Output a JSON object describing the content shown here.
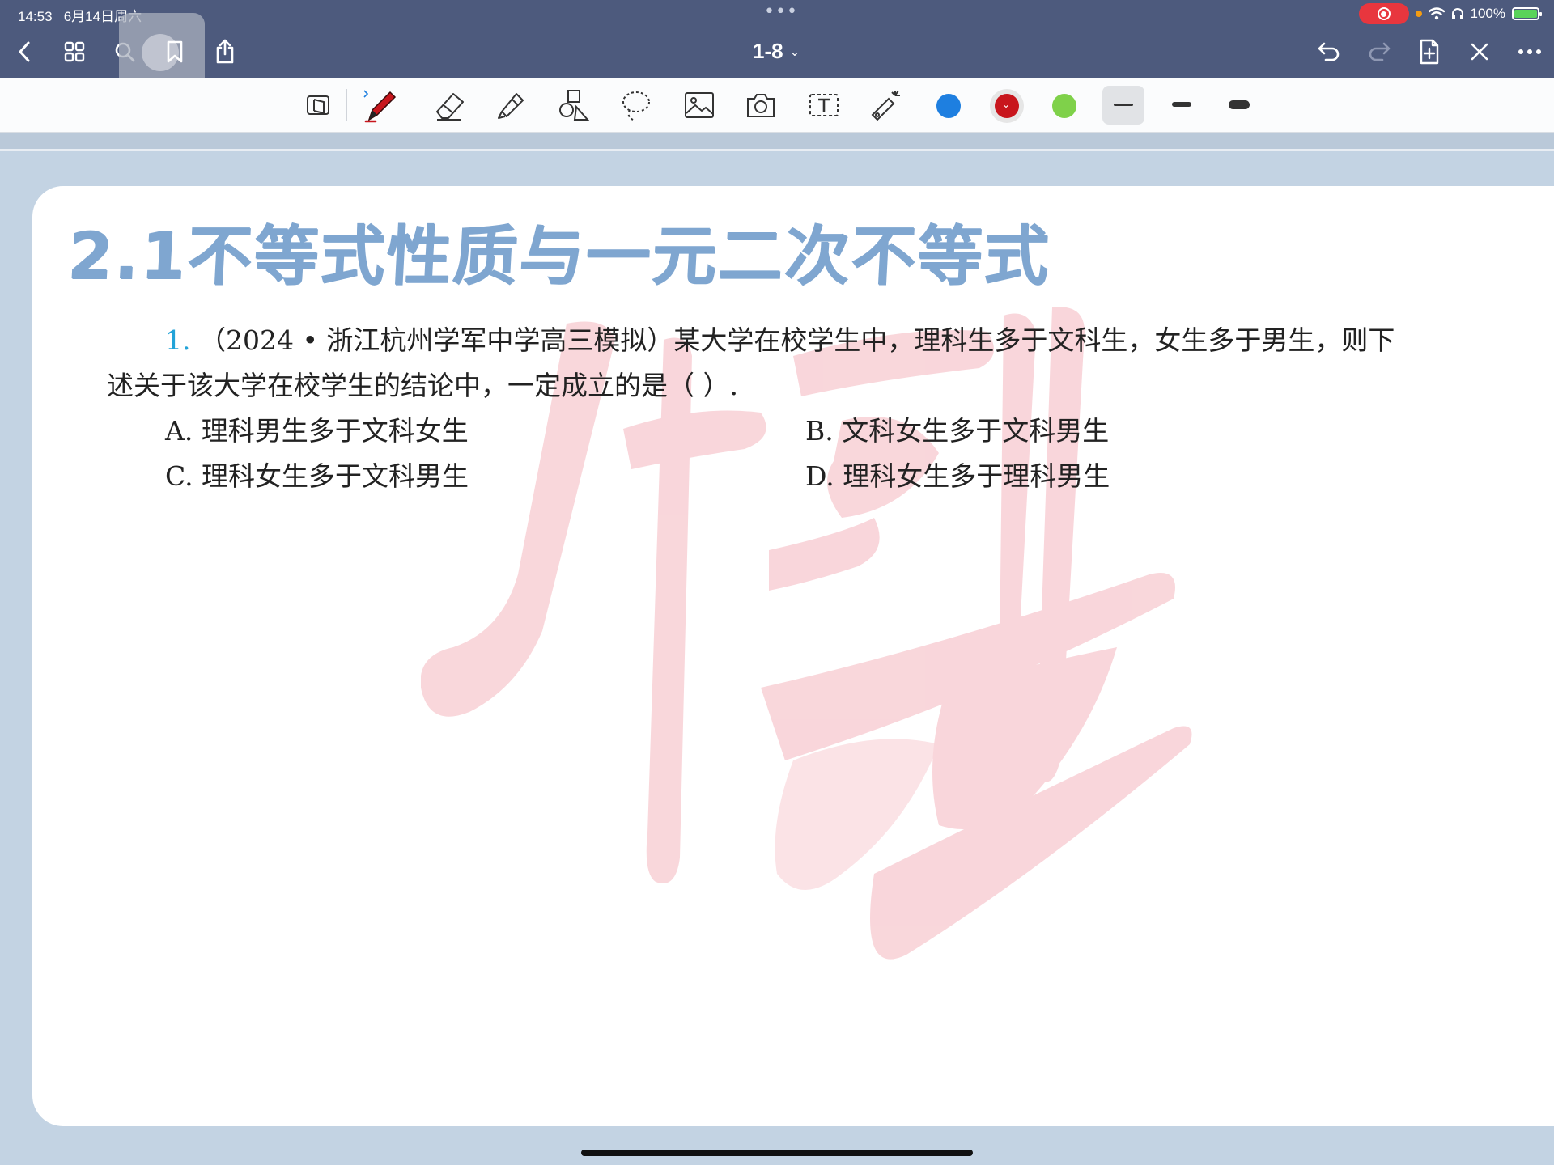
{
  "status_bar": {
    "time": "14:53",
    "date": "6月14日周六",
    "battery": "100%"
  },
  "nav": {
    "page_range": "1-8",
    "icons": [
      "back-icon",
      "grid-icon",
      "search-icon",
      "bookmark-icon",
      "share-icon",
      "undo-icon",
      "redo-icon",
      "add-page-icon",
      "close-icon",
      "more-icon"
    ]
  },
  "toolbar": {
    "tools": [
      "reading-mode-icon",
      "pen-icon",
      "eraser-icon",
      "highlighter-icon",
      "shapes-icon",
      "lasso-icon",
      "image-icon",
      "camera-icon",
      "text-box-icon",
      "laser-pointer-icon"
    ],
    "colors": [
      "#1e7fe0",
      "#c8161d",
      "#7fd14a"
    ],
    "selected_color": "#c8161d",
    "stroke_widths": [
      "thin",
      "medium",
      "thick"
    ],
    "selected_stroke": "thin"
  },
  "page": {
    "title": "2.1不等式性质与一元二次不等式",
    "question": {
      "number": "1.",
      "line1": "（2024 • 浙江杭州学军中学高三模拟）某大学在校学生中，理科生多于文科生，女生多于男生，则下",
      "line2": "述关于该大学在校学生的结论中，一定成立的是（        ）."
    },
    "options": {
      "A": "A.  理科男生多于文科女生",
      "B": "B.  文科女生多于文科男生",
      "C": "C.  理科女生多于文科男生",
      "D": "D.  理科女生多于理科男生"
    },
    "watermark_color": "#f7c9cf"
  }
}
